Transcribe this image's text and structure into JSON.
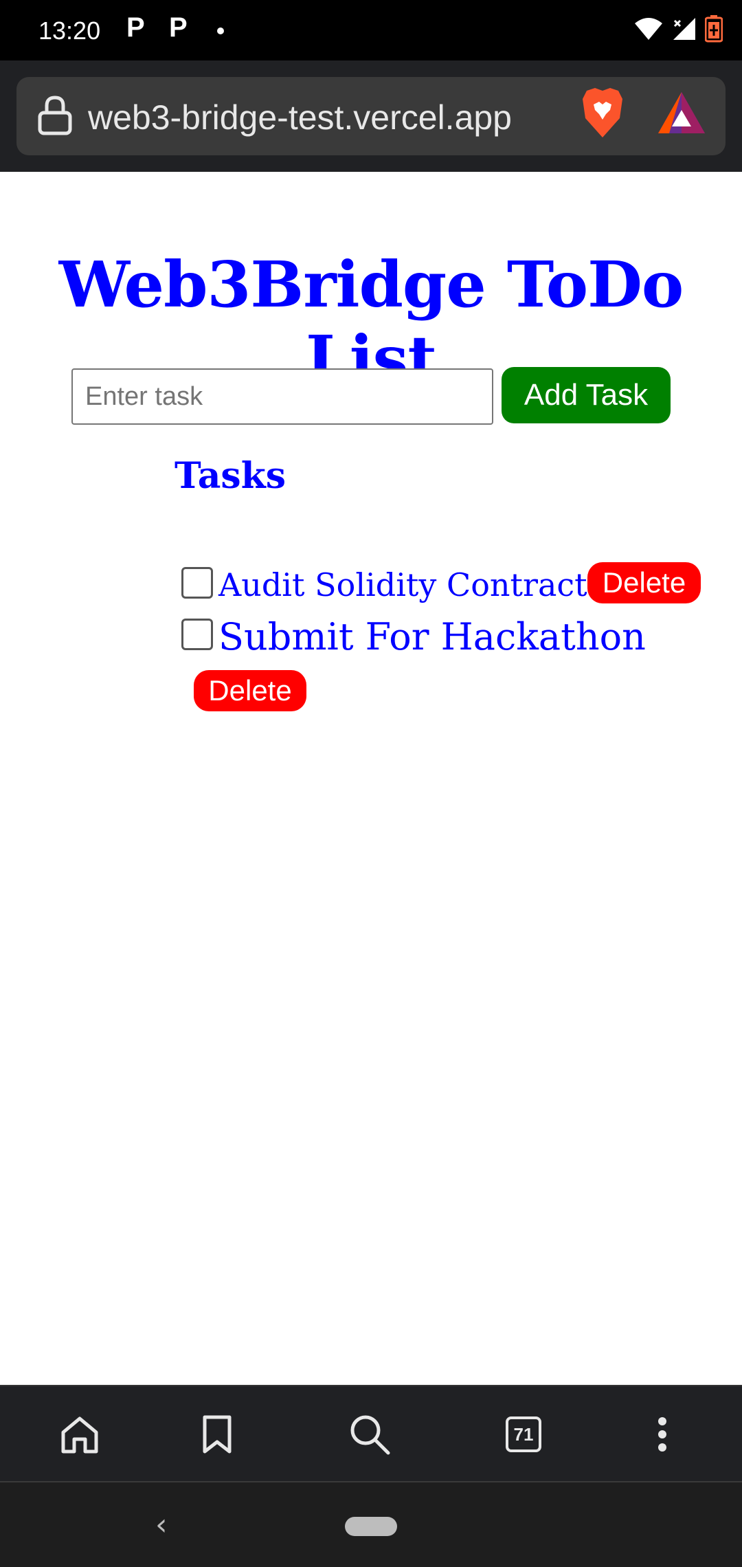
{
  "status_bar": {
    "time": "13:20",
    "notification_icons": [
      "P",
      "P"
    ],
    "icons": [
      "wifi-icon",
      "signal-icon",
      "battery-icon"
    ]
  },
  "browser": {
    "url": "web3-bridge-test.vercel.app",
    "icons": [
      "lock-icon",
      "brave-shield-icon",
      "bat-rewards-icon"
    ]
  },
  "page": {
    "title": "Web3Bridge ToDo List",
    "input_placeholder": "Enter task",
    "add_button_label": "Add Task",
    "tasks_heading": "Tasks",
    "tasks": [
      {
        "label": "Audit Solidity Contract",
        "completed": false,
        "delete_label": "Delete"
      },
      {
        "label": "Submit For Hackathon",
        "completed": false,
        "delete_label": "Delete"
      }
    ]
  },
  "toolbar": {
    "tabs_count": "71",
    "icons": [
      "home-icon",
      "bookmark-icon",
      "search-icon",
      "tabs-icon",
      "more-icon"
    ]
  },
  "nav": {
    "back_glyph": "‹"
  },
  "colors": {
    "title": "#0000ff",
    "add_button": "#008000",
    "delete_button": "#ff0000",
    "browser_chrome": "#202124"
  }
}
